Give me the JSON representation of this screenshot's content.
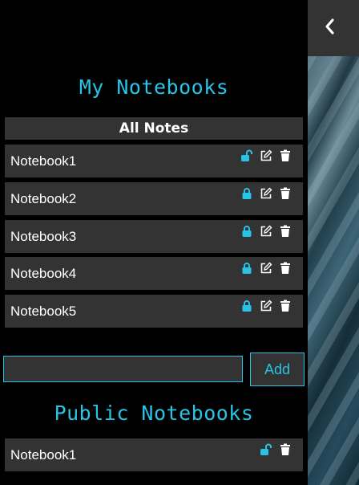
{
  "my_notebooks": {
    "title": "My Notebooks",
    "all_notes_label": "All Notes",
    "items": [
      {
        "name": "Notebook1",
        "lock": "unlocked"
      },
      {
        "name": "Notebook2",
        "lock": "locked"
      },
      {
        "name": "Notebook3",
        "lock": "locked"
      },
      {
        "name": "Notebook4",
        "lock": "locked"
      },
      {
        "name": "Notebook5",
        "lock": "locked"
      }
    ]
  },
  "add_form": {
    "input_value": "",
    "button_label": "Add"
  },
  "public_notebooks": {
    "title": "Public Notebooks",
    "items": [
      {
        "name": "Notebook1",
        "lock": "unlocked"
      }
    ]
  },
  "colors": {
    "accent": "#27c4e6",
    "row_bg": "#333333",
    "background": "#000000"
  },
  "icons": [
    "chevron-left-icon",
    "lock-icon",
    "unlock-icon",
    "edit-icon",
    "trash-icon"
  ]
}
